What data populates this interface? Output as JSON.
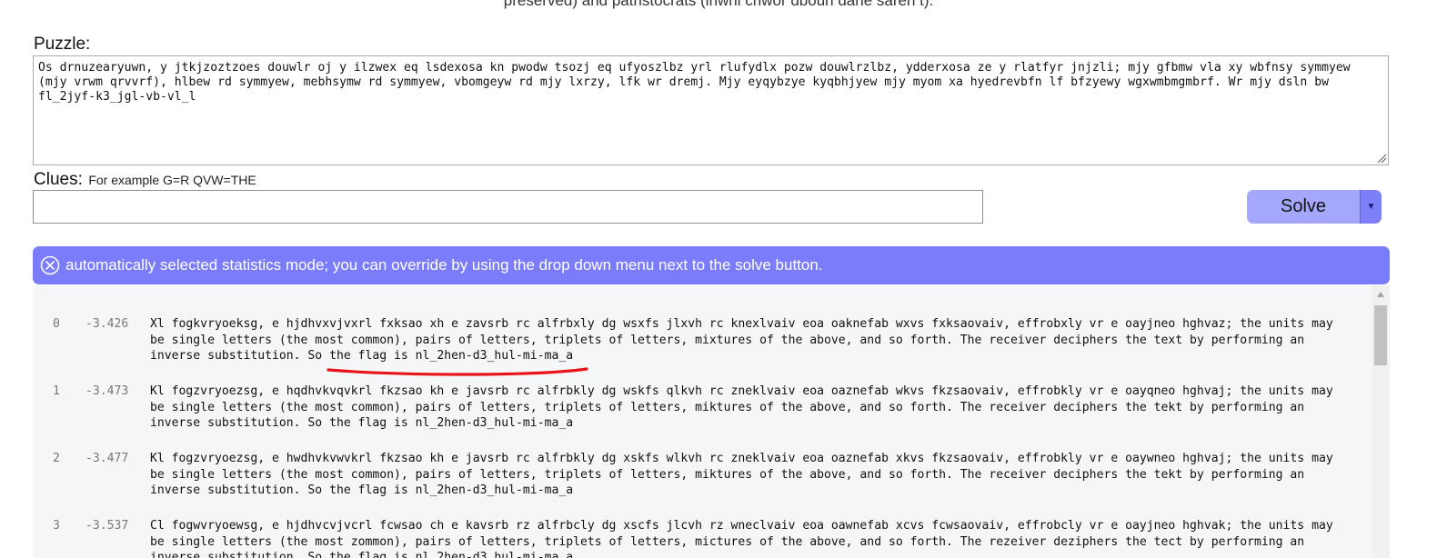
{
  "top_text": "preserved) and patristocrats (inwhi chwor dboun dane saren t).",
  "puzzle": {
    "label": "Puzzle:",
    "value": "Os drnuzearyuwn, y jtkjzoztzoes douwlr oj y ilzwex eq lsdexosa kn pwodw tsozj eq ufyoszlbz yrl rlufydlx pozw douwlrzlbz, ydderxosa ze y rlatfyr jnjzli; mjy gfbmw vla xy wbfnsy symmyew (mjy vrwm qrvvrf), hlbew rd symmyew, mebhsymw rd symmyew, vbomgeyw rd mjy lxrzy, lfk wr dremj. Mjy eyqybzye kyqbhjyew mjy myom xa hyedrevbfn lf bfzyewy wgxwmbmgmbrf. Wr mjy dsln bw fl_2jyf-k3_jgl-vb-vl_l"
  },
  "clues": {
    "label": "Clues:",
    "hint": "For example G=R QVW=THE",
    "value": ""
  },
  "solve": {
    "label": "Solve",
    "dropdown_glyph": "▼"
  },
  "banner": {
    "text": "automatically selected statistics mode; you can override by using the drop down menu next to the solve button."
  },
  "results": [
    {
      "index": "0",
      "score": "-3.426",
      "text": "Xl fogkvryoeksg, e hjdhvxvjvxrl fxksao xh e zavsrb rc alfrbxly dg wsxfs jlxvh rc knexlvaiv eoa oaknefab wxvs fxksaovaiv, effrobxly vr e oayjneo hghvaz; the units may be single letters (the most common), pairs of letters, triplets of letters, mixtures of the above, and so forth. The receiver deciphers the text by performing an inverse substitution. So the flag is nl_2hen-d3_hul-mi-ma_a"
    },
    {
      "index": "1",
      "score": "-3.473",
      "text": "Kl fogzvryoezsg, e hqdhvkvqvkrl fkzsao kh e javsrb rc alfrbkly dg wskfs qlkvh rc zneklvaiv eoa oaznefab wkvs fkzsaovaiv, effrobkly vr e oayqneo hghvaj; the units may be single letters (the most common), pairs of letters, triplets of letters, miktures of the above, and so forth. The receiver deciphers the tekt by performing an inverse substitution. So the flag is nl_2hen-d3_hul-mi-ma_a"
    },
    {
      "index": "2",
      "score": "-3.477",
      "text": "Kl fogzvryoezsg, e hwdhvkvwvkrl fkzsao kh e javsrb rc alfrbkly dg xskfs wlkvh rc zneklvaiv eoa oaznefab xkvs fkzsaovaiv, effrobkly vr e oaywneo hghvaj; the units may be single letters (the most common), pairs of letters, triplets of letters, miktures of the above, and so forth. The receiver deciphers the tekt by performing an inverse substitution. So the flag is nl_2hen-d3_hul-mi-ma_a"
    },
    {
      "index": "3",
      "score": "-3.537",
      "text": "Cl fogwvryoewsg, e hjdhvcvjvcrl fcwsao ch e kavsrb rz alfrbcly dg xscfs jlcvh rz wneclvaiv eoa oawnefab xcvs fcwsaovaiv, effrobcly vr e oayjneo hghvak; the units may be single letters (the most zommon), pairs of letters, triplets of letters, mictures of the above, and so forth. The rezeiver deziphers the tect by performing an inverse substitution. So the flag is nl_2hen-d3_hul-mi-ma_a"
    }
  ],
  "colors": {
    "banner": "#7b7cf9",
    "solve_button": "#a4a7fb",
    "solve_dropdown": "#7c7ff7",
    "annotation": "#e8141a"
  }
}
